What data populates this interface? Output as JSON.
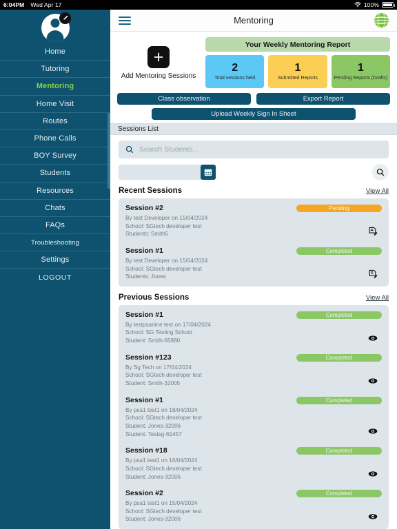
{
  "status_bar": {
    "time": "6:04PM",
    "date": "Wed Apr 17",
    "battery_pct": "100%",
    "wifi_icon": "wifi-icon",
    "battery_icon": "battery-icon"
  },
  "sidebar": {
    "avatar_icon": "user-avatar-icon",
    "avatar_edit_icon": "pencil-edit-icon",
    "items": [
      {
        "label": "Home",
        "active": false
      },
      {
        "label": "Tutoring",
        "active": false
      },
      {
        "label": "Mentoring",
        "active": true
      },
      {
        "label": "Home Visit",
        "active": false
      },
      {
        "label": "Routes",
        "active": false
      },
      {
        "label": "Phone Calls",
        "active": false
      },
      {
        "label": "BOY Survey",
        "active": false
      },
      {
        "label": "Students",
        "active": false
      },
      {
        "label": "Resources",
        "active": false
      },
      {
        "label": "Chats",
        "active": false
      },
      {
        "label": "FAQs",
        "active": false
      },
      {
        "label": "Troubleshooting",
        "active": false
      },
      {
        "label": "Settings",
        "active": false
      },
      {
        "label": "LOGOUT",
        "active": false
      }
    ]
  },
  "topbar": {
    "menu_icon": "hamburger-menu-icon",
    "title": "Mentoring",
    "logo_icon": "globe-logo-icon"
  },
  "hero": {
    "add_icon": "plus-icon",
    "add_label": "Add Mentoring Sessions",
    "weekly_banner": "Your Weekly Mentoring Report",
    "stats": [
      {
        "value": "2",
        "label": "Total sessions held",
        "color": "#5bc8f5"
      },
      {
        "value": "1",
        "label": "Submitted Reports",
        "color": "#fbce54"
      },
      {
        "value": "1",
        "label": "Pending Reports (Drafts)",
        "color": "#8cc765"
      }
    ],
    "buttons": {
      "class_observation": "Class observation",
      "export_report": "Export Report",
      "upload_sheet": "Upload Weekly Sign In Sheet"
    }
  },
  "sessions_section": {
    "header": "Sessions List",
    "search": {
      "placeholder": "Search Students...",
      "value": "",
      "icon": "search-icon"
    },
    "filter": {
      "date_value": "",
      "calendar_icon": "calendar-icon",
      "search_icon": "search-icon"
    },
    "groups": [
      {
        "title": "Recent Sessions",
        "view_all": "View All",
        "sessions": [
          {
            "title": "Session #2",
            "status": "Pending",
            "status_kind": "pending",
            "by": "By test Developer on 15/04/2024",
            "school": "School: SGtech developer test",
            "students": "Students: Smith5",
            "extra": "",
            "action_icon": "edit-report-icon"
          },
          {
            "title": "Session #1",
            "status": "Completed",
            "status_kind": "completed",
            "by": "By test Developer on 15/04/2024",
            "school": "School: SGtech developer test",
            "students": "Students: Jones",
            "extra": "",
            "action_icon": "edit-report-icon"
          }
        ]
      },
      {
        "title": "Previous Sessions",
        "view_all": "View All",
        "sessions": [
          {
            "title": "Session #1",
            "status": "Completed",
            "status_kind": "completed",
            "by": "By testpsanine test on 17/04/2024",
            "school": "School: SG Testing School",
            "students": "Student: Smith-65880",
            "extra": "",
            "action_icon": "eye-view-icon"
          },
          {
            "title": "Session #123",
            "status": "Completed",
            "status_kind": "completed",
            "by": "By Sg Tech on 17/04/2024",
            "school": "School: SGtech developer test",
            "students": "Student: Smith-32005",
            "extra": "",
            "action_icon": "eye-view-icon"
          },
          {
            "title": "Session #1",
            "status": "Completed",
            "status_kind": "completed",
            "by": "By psa1 test1 on 18/04/2024",
            "school": "School: SGtech developer test",
            "students": "Student: Jones-32006",
            "extra": "Student: Testsg-61457",
            "action_icon": "eye-view-icon"
          },
          {
            "title": "Session #18",
            "status": "Completed",
            "status_kind": "completed",
            "by": "By psa1 test1 on 16/04/2024",
            "school": "School: SGtech developer test",
            "students": "Student: Jones-32006",
            "extra": "",
            "action_icon": "eye-view-icon"
          },
          {
            "title": "Session #2",
            "status": "Completed",
            "status_kind": "completed",
            "by": "By psa1 test1 on 15/04/2024",
            "school": "School: SGtech developer test",
            "students": "Student: Jones-32006",
            "extra": "",
            "action_icon": "eye-view-icon"
          }
        ]
      }
    ]
  },
  "colors": {
    "sidebar_bg": "#0e5270",
    "accent_active": "#8ed23f",
    "panel_bg": "#dde5ea",
    "pending": "#f5a623",
    "completed": "#8cc765",
    "banner": "#b7d9ab"
  }
}
